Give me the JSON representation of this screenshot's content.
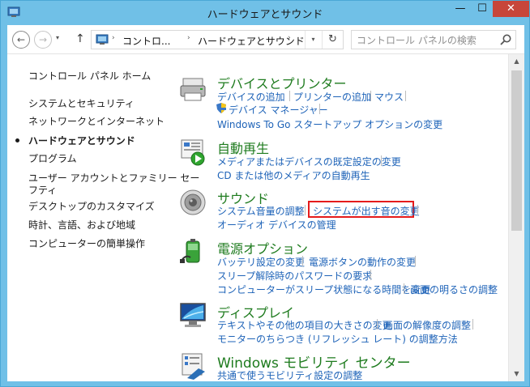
{
  "window": {
    "title": "ハードウェアとサウンド",
    "minimize_glyph": "—",
    "maximize_glyph": "☐",
    "close_glyph": "✕"
  },
  "nav": {
    "back_glyph": "←",
    "forward_glyph": "→",
    "recent_glyph": "▾",
    "up_glyph": "↑"
  },
  "address": {
    "sep_glyph": "›",
    "crumbs": [
      "コントロ...",
      "ハードウェアとサウンド"
    ],
    "dropdown_glyph": "▾",
    "refresh_glyph": "↻"
  },
  "search": {
    "placeholder": "コントロール パネルの検索"
  },
  "sidebar": {
    "items": [
      "コントロール パネル ホーム",
      "システムとセキュリティ",
      "ネットワークとインターネット",
      "ハードウェアとサウンド",
      "プログラム",
      "ユーザー アカウントとファミリー セー",
      "フティ",
      "デスクトップのカスタマイズ",
      "時計、言語、および地域",
      "コンピューターの簡単操作"
    ],
    "active_index": 3
  },
  "categories": {
    "devices": {
      "title": "デバイスとプリンター",
      "links": [
        "デバイスの追加",
        "プリンターの追加",
        "マウス",
        "デバイス マネージャー",
        "Windows To Go スタートアップ オプションの変更"
      ]
    },
    "autoplay": {
      "title": "自動再生",
      "links": [
        "メディアまたはデバイスの既定設定の変更",
        "CD または他のメディアの自動再生"
      ]
    },
    "sound": {
      "title": "サウンド",
      "links": [
        "システム音量の調整",
        "システムが出す音の変更",
        "オーディオ デバイスの管理"
      ],
      "highlight_color": "#e51b1b"
    },
    "power": {
      "title": "電源オプション",
      "links": [
        "バッテリ設定の変更",
        "電源ボタンの動作の変更",
        "スリープ解除時のパスワードの要求",
        "コンピューターがスリープ状態になる時間を変更",
        "画面の明るさの調整"
      ]
    },
    "display": {
      "title": "ディスプレイ",
      "links": [
        "テキストやその他の項目の大きさの変更",
        "画面の解像度の調整",
        "モニターのちらつき (リフレッシュ レート) の調整方法"
      ]
    },
    "mobility": {
      "title": "Windows モビリティ センター",
      "links": [
        "共通で使うモビリティ設定の調整"
      ]
    }
  },
  "scrollbar": {
    "up_glyph": "▲",
    "down_glyph": "▼"
  },
  "colors": {
    "title_bar": "#70c0e7",
    "link": "#1e63b8",
    "category_title": "#1e7b1e",
    "close_button": "#c7463a"
  }
}
